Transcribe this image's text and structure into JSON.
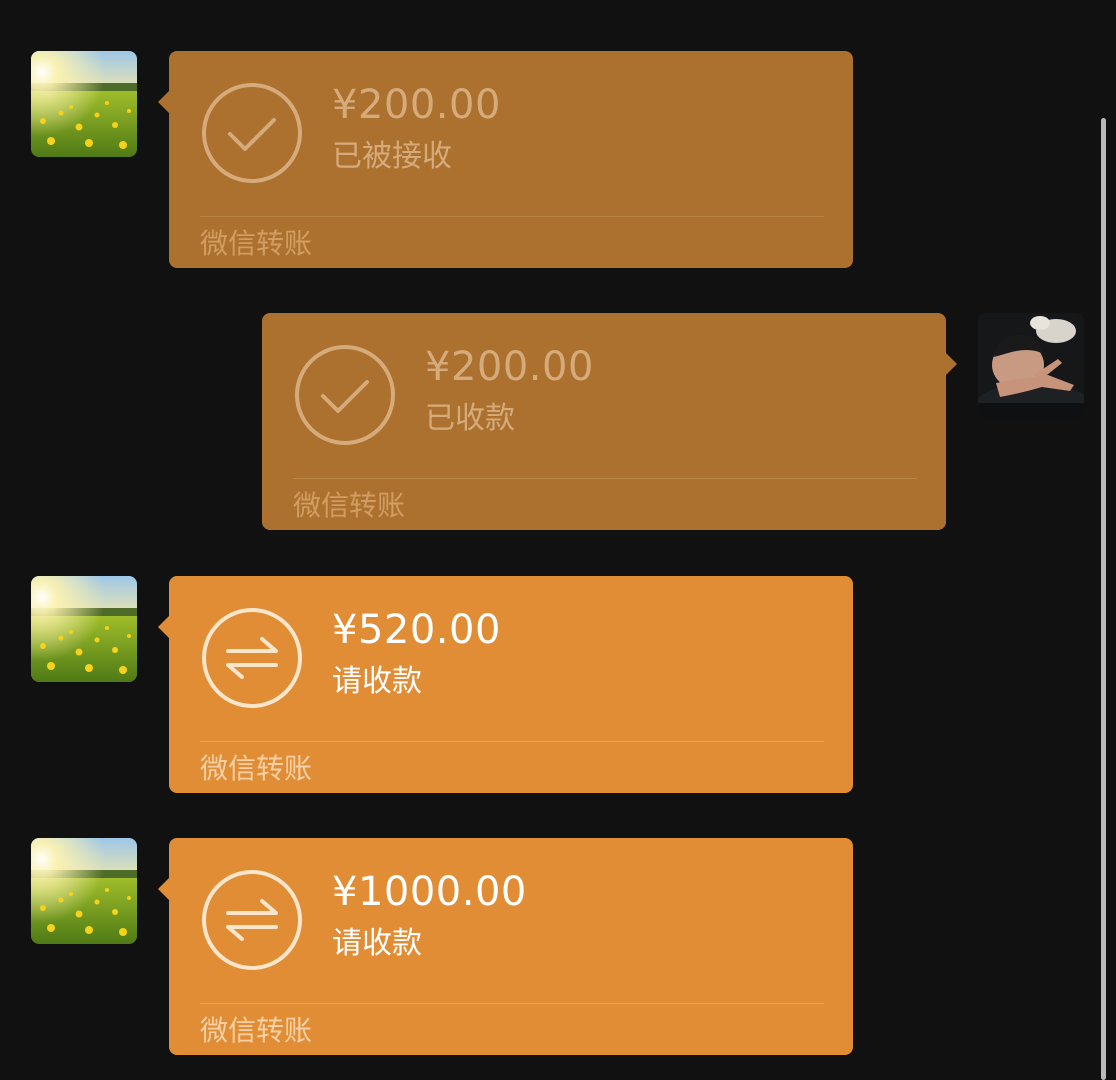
{
  "messages": [
    {
      "side": "received",
      "state": "done",
      "amount": "¥200.00",
      "status": "已被接收",
      "footer": "微信转账",
      "icon": "check-circle-icon",
      "avatar": "meadow-avatar"
    },
    {
      "side": "sent",
      "state": "done",
      "amount": "¥200.00",
      "status": "已收款",
      "footer": "微信转账",
      "icon": "check-circle-icon",
      "avatar": "user-photo-avatar"
    },
    {
      "side": "received",
      "state": "pending",
      "amount": "¥520.00",
      "status": "请收款",
      "footer": "微信转账",
      "icon": "transfer-arrows-icon",
      "avatar": "meadow-avatar"
    },
    {
      "side": "received",
      "state": "pending",
      "amount": "¥1000.00",
      "status": "请收款",
      "footer": "微信转账",
      "icon": "transfer-arrows-icon",
      "avatar": "meadow-avatar"
    }
  ],
  "colors": {
    "background": "#111111",
    "completed_bubble": "#ac712e",
    "pending_bubble": "#e08d35",
    "completed_text": "#d6ab7c",
    "pending_text": "#ffffff"
  }
}
